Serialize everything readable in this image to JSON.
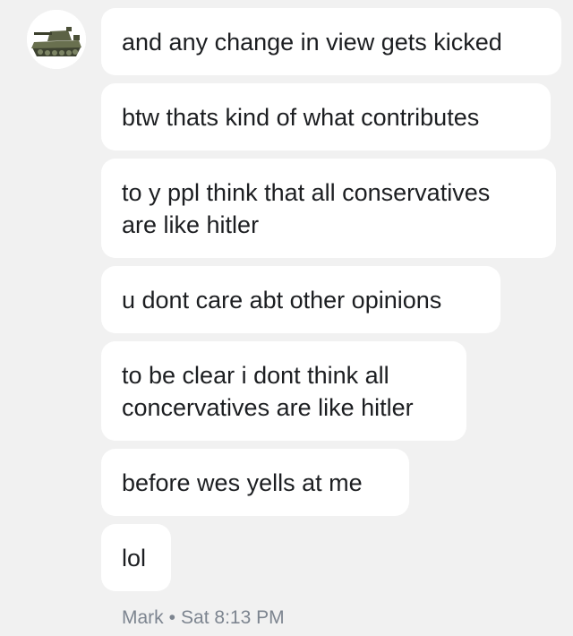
{
  "sender": {
    "avatar_icon": "tank-avatar-icon",
    "name": "Mark",
    "separator": "•",
    "timestamp": "Sat 8:13 PM"
  },
  "messages": [
    {
      "lines": [
        "and any change in view gets kicked"
      ]
    },
    {
      "lines": [
        "btw thats kind of what contributes"
      ]
    },
    {
      "lines": [
        "to y ppl think that all conservatives",
        "are like hitler"
      ]
    },
    {
      "lines": [
        "u dont care abt other opinions"
      ]
    },
    {
      "lines": [
        "to be clear i dont think all",
        "concervatives are like hitler"
      ]
    },
    {
      "lines": [
        "before wes yells at me"
      ]
    },
    {
      "lines": [
        "lol"
      ]
    }
  ],
  "colors": {
    "background": "#f1f1f1",
    "bubble": "#ffffff",
    "text": "#1c1e21",
    "meta": "#7d8590"
  }
}
